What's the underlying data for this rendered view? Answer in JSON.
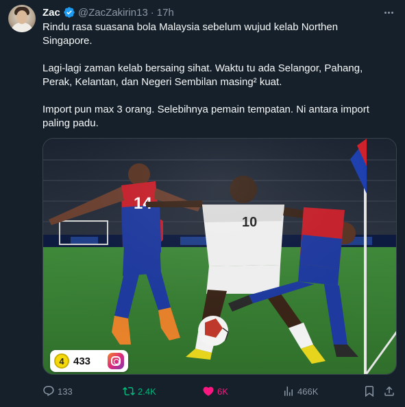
{
  "user": {
    "name": "Zac",
    "handle": "@ZacZakirin13",
    "separator": "·",
    "time": "17h"
  },
  "tweet": {
    "paragraphs": [
      "Rindu rasa suasana bola Malaysia sebelum wujud kelab Northen Singapore.",
      "Lagi-lagi zaman kelab bersaing sihat. Waktu tu ada Selangor, Pahang, Perak, Kelantan, dan Negeri Sembilan masing² kuat.",
      "Import pun max 3 orang. Selebihnya pemain tempatan. Ni antara import paling padu."
    ]
  },
  "media": {
    "badge": {
      "coin_label": "4",
      "count": "433"
    },
    "jersey_numbers": [
      "14",
      "10"
    ]
  },
  "actions": {
    "replies": "133",
    "retweets": "2.4K",
    "likes": "6K",
    "views": "466K"
  },
  "colors": {
    "background": "#15202b",
    "text": "#f7f9f9",
    "muted": "#8b98a5",
    "retweet_active": "#00ba7c",
    "like_active": "#f91880",
    "verified": "#1d9bf0"
  }
}
